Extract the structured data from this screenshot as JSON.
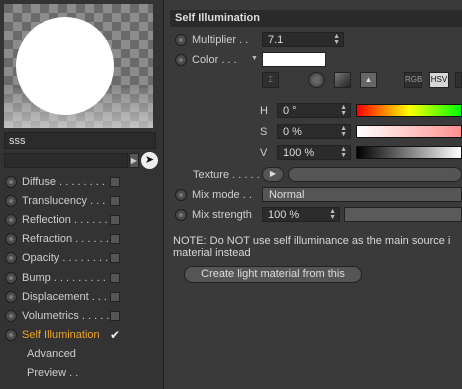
{
  "material": {
    "name": "sss"
  },
  "channels": [
    {
      "label": "Diffuse . . . . . . . .",
      "has_radio": true,
      "has_check": true,
      "active": false
    },
    {
      "label": "Translucency . . . .",
      "has_radio": true,
      "has_check": true,
      "active": false
    },
    {
      "label": "Reflection . . . . . .",
      "has_radio": true,
      "has_check": true,
      "active": false
    },
    {
      "label": "Refraction . . . . . .",
      "has_radio": true,
      "has_check": true,
      "active": false
    },
    {
      "label": "Opacity . . . . . . . .",
      "has_radio": true,
      "has_check": true,
      "active": false
    },
    {
      "label": "Bump . . . . . . . . . .",
      "has_radio": true,
      "has_check": true,
      "active": false
    },
    {
      "label": "Displacement . . . .",
      "has_radio": true,
      "has_check": true,
      "active": false
    },
    {
      "label": "Volumetrics . . . . . .",
      "has_radio": true,
      "has_check": true,
      "active": false
    },
    {
      "label": "Self Illumination",
      "has_radio": true,
      "has_check": true,
      "active": true,
      "checked": true
    },
    {
      "label": "Advanced",
      "has_radio": false,
      "has_check": false,
      "active": false
    },
    {
      "label": "Preview . .",
      "has_radio": false,
      "has_check": false,
      "active": false
    }
  ],
  "panel": {
    "title": "Self Illumination",
    "multiplier": {
      "label": "Multiplier . .",
      "value": "7.1"
    },
    "color": {
      "label": "Color . . .",
      "value_hex": "#ffffff"
    },
    "color_mode_buttons": {
      "rgb": "RGB",
      "hsv": "HSV",
      "selected": "HSV"
    },
    "h": {
      "label": "H",
      "value": "0 °"
    },
    "s": {
      "label": "S",
      "value": "0 %"
    },
    "v": {
      "label": "V",
      "value": "100 %"
    },
    "texture": {
      "label": "Texture . . . . . . . ."
    },
    "mix_mode": {
      "label": "Mix mode . .",
      "value": "Normal"
    },
    "mix_strength": {
      "label": "Mix strength",
      "value": "100 %",
      "level_fraction": 1.0
    },
    "note": "NOTE: Do NOT use self illuminance as the main source i\nmaterial instead",
    "create_button": "Create light material from this"
  },
  "colors": {
    "accent_active": "#f0a325",
    "panel_bg": "#3a3a3a",
    "field_bg": "#2b2b2b"
  }
}
